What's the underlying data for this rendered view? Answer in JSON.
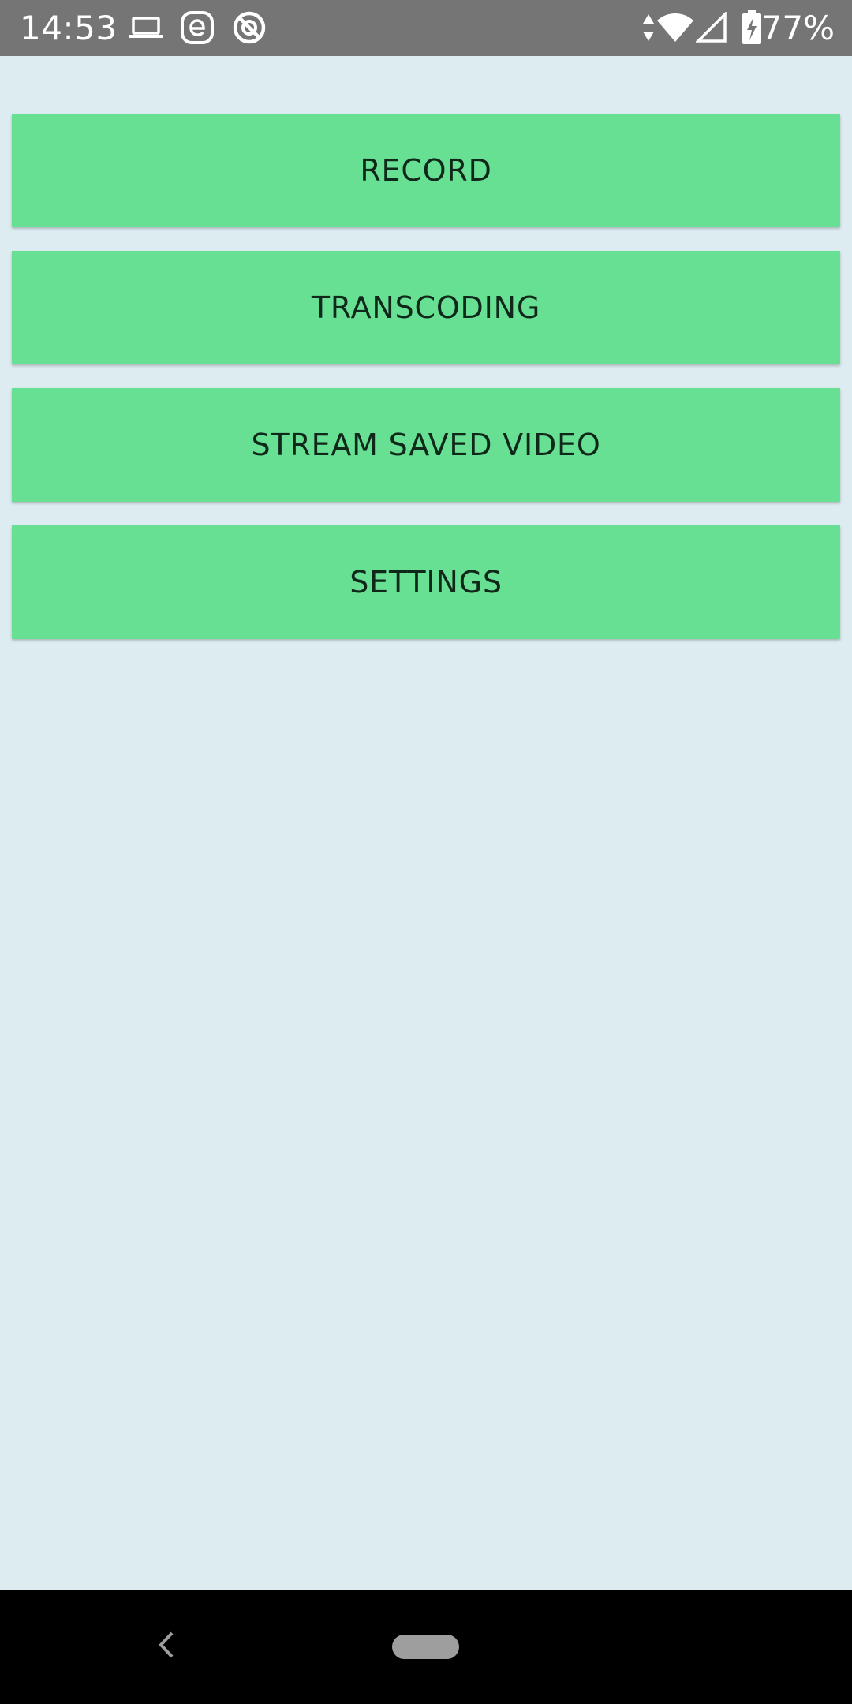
{
  "status_bar": {
    "time": "14:53",
    "left_icons": [
      "laptop-icon",
      "e-circle-icon",
      "no-disturb-circle-icon"
    ],
    "right_icons": [
      "data-arrows-icon",
      "wifi-icon",
      "cell-signal-icon",
      "battery-charging-icon"
    ],
    "battery_percent": "77%"
  },
  "menu": {
    "buttons": [
      {
        "label": "RECORD"
      },
      {
        "label": "TRANSCODING"
      },
      {
        "label": "STREAM SAVED VIDEO"
      },
      {
        "label": "SETTINGS"
      }
    ]
  },
  "nav_bar": {
    "icons": [
      "back-icon",
      "home-pill-icon"
    ]
  },
  "colors": {
    "background": "#ddecf1",
    "button": "#68e094",
    "status_bar": "#757575",
    "nav_bar": "#000000"
  }
}
